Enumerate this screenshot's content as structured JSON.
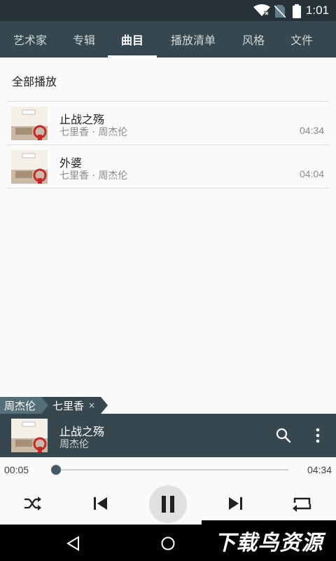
{
  "status_bar": {
    "time": "1:01",
    "icons": [
      "wifi-icon",
      "no-sim-icon",
      "battery-icon"
    ],
    "bg_color": "#263238"
  },
  "tabs": [
    {
      "label": "艺术家",
      "active": false
    },
    {
      "label": "专辑",
      "active": false
    },
    {
      "label": "曲目",
      "active": true
    },
    {
      "label": "播放清单",
      "active": false
    },
    {
      "label": "风格",
      "active": false
    },
    {
      "label": "文件",
      "active": false
    }
  ],
  "play_all_label": "全部播放",
  "tracks": [
    {
      "title": "止战之殇",
      "subtitle": "七里香 · 周杰伦",
      "duration": "04:34"
    },
    {
      "title": "外婆",
      "subtitle": "七里香 · 周杰伦",
      "duration": "04:04"
    }
  ],
  "breadcrumb": [
    {
      "label": "周杰伦"
    },
    {
      "label": "七里香",
      "close": "×"
    }
  ],
  "now_playing": {
    "title": "止战之殇",
    "artist": "周杰伦"
  },
  "playback": {
    "elapsed": "00:05",
    "total": "04:34",
    "progress": 0.018
  },
  "controls": [
    "shuffle-icon",
    "previous-icon",
    "pause-icon",
    "next-icon",
    "repeat-icon"
  ],
  "nav_bar": [
    "back-icon",
    "home-icon"
  ],
  "watermark": "下载鸟资源",
  "colors": {
    "accent": "#37474f",
    "secondary_text": "#8a8a8a"
  }
}
